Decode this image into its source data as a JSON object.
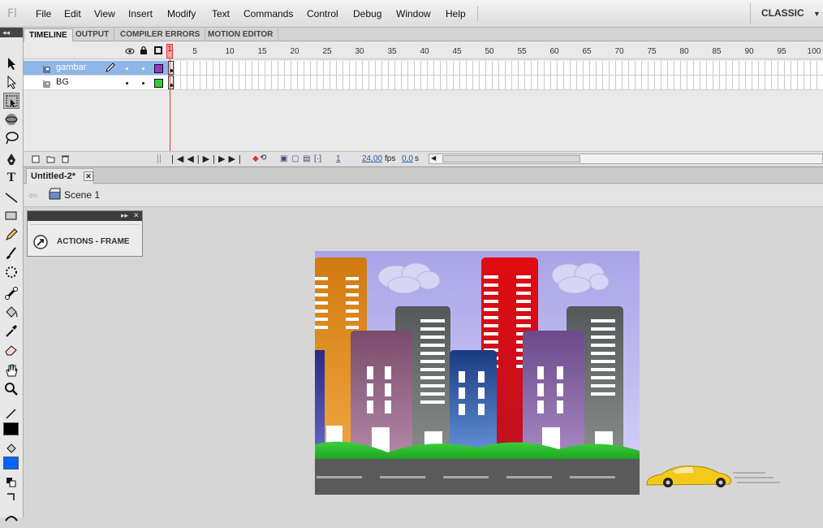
{
  "app": {
    "logo": "Fl",
    "workspace": "CLASSIC",
    "workspace_arrow": "▼"
  },
  "menu": [
    "File",
    "Edit",
    "View",
    "Insert",
    "Modify",
    "Text",
    "Commands",
    "Control",
    "Debug",
    "Window",
    "Help"
  ],
  "panel_tabs": [
    "TIMELINE",
    "OUTPUT",
    "COMPILER ERRORS",
    "MOTION EDITOR"
  ],
  "timeline": {
    "frame_numbers": [
      "1",
      "5",
      "10",
      "15",
      "20",
      "25",
      "30",
      "35",
      "40",
      "45",
      "50",
      "55",
      "60",
      "65",
      "70",
      "75",
      "80",
      "85",
      "90",
      "95",
      "100"
    ],
    "layers": [
      {
        "name": "gambar",
        "color": "#9933cc",
        "selected": true
      },
      {
        "name": "BG",
        "color": "#33cc33",
        "selected": false
      }
    ],
    "current_frame": "1",
    "fps": "24,00",
    "fps_unit": "fps",
    "time": "0,0",
    "time_unit": "s"
  },
  "document": {
    "tab_title": "Untitled-2*",
    "close": "✕",
    "scene": "Scene 1"
  },
  "actions_panel": {
    "title": "ACTIONS - FRAME"
  },
  "colors": {
    "stroke": "#000000",
    "fill": "#0066ff",
    "sky_top": "#a9a4e8",
    "road": "#5a5a5a"
  }
}
